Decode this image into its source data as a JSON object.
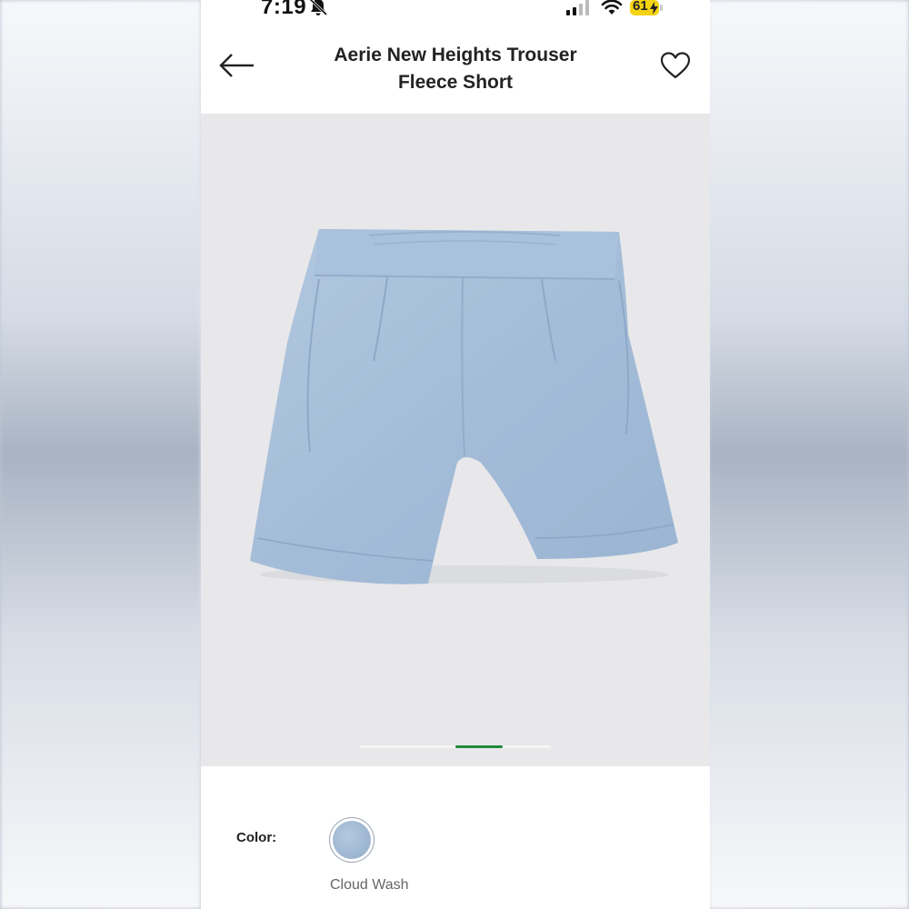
{
  "status_bar": {
    "time": "7:19",
    "battery_level": "61",
    "icons": [
      "bell-slash-icon",
      "cellular-signal-icon",
      "wifi-icon",
      "battery-charging-icon"
    ]
  },
  "header": {
    "back_icon": "arrow-left-icon",
    "title": "Aerie New Heights Trouser Fleece Short",
    "favorite_icon": "heart-icon"
  },
  "gallery": {
    "image_count": 3,
    "active_index": 1,
    "active_color": "#1e8a3a"
  },
  "color_selector": {
    "label": "Color:",
    "selected_name": "Cloud Wash",
    "swatch_color": "#a3bad5"
  }
}
